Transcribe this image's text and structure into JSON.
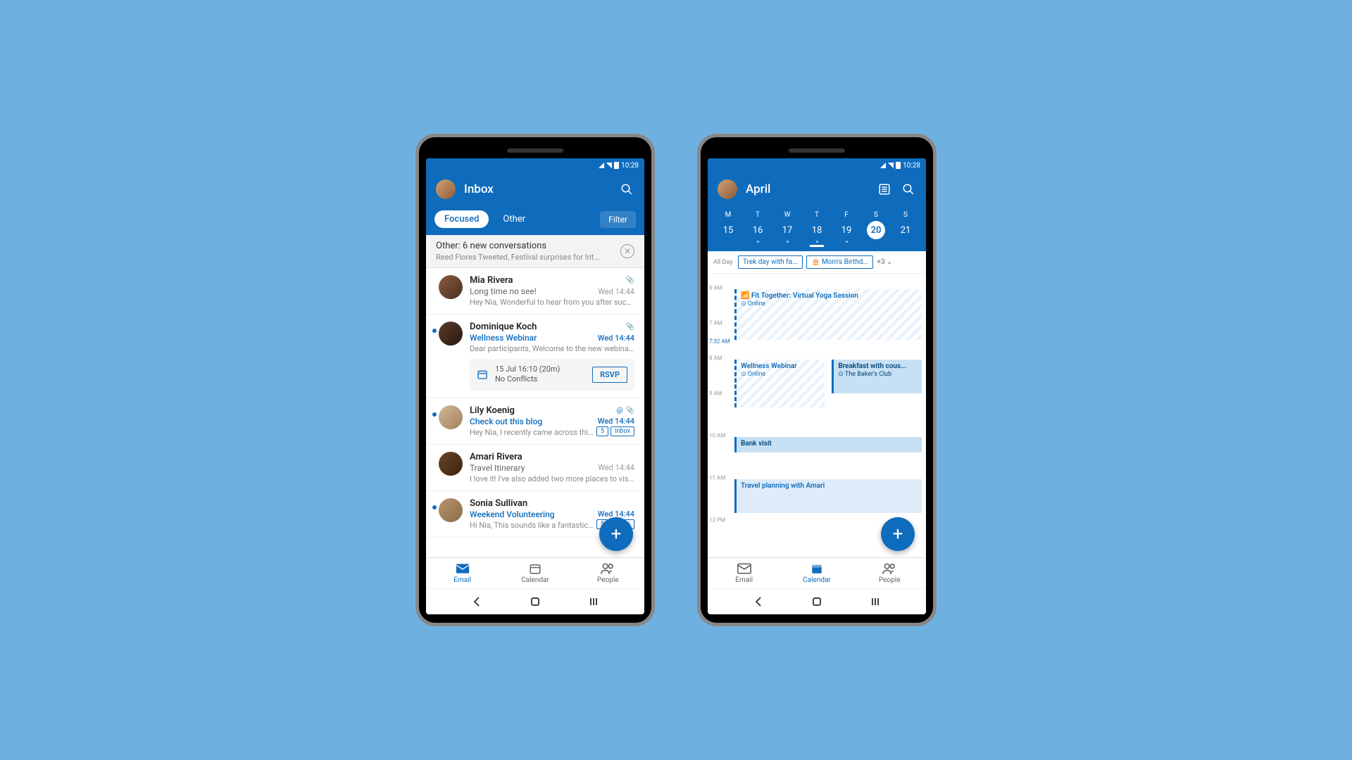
{
  "status": {
    "time": "10:28"
  },
  "inbox": {
    "title": "Inbox",
    "tabs": {
      "focused": "Focused",
      "other": "Other",
      "filter": "Filter"
    },
    "other_banner": {
      "title": "Other: 6 new conversations",
      "sub": "Reed Flores Tweeted, Festival surprises for Int..."
    },
    "emails": [
      {
        "sender": "Mia Rivera",
        "subject": "Long time no see!",
        "time": "Wed 14:44",
        "preview": "Hey Nia, Wonderful to hear from you after such..."
      },
      {
        "sender": "Dominique Koch",
        "subject": "Wellness Webinar",
        "time": "Wed 14:44",
        "preview": "Dear participants, Welcome to the new webinar...",
        "rsvp_time": "15 Jul 16:10 (20m)",
        "rsvp_status": "No Conflicts",
        "rsvp_btn": "RSVP"
      },
      {
        "sender": "Lily Koenig",
        "subject": "Check out this blog",
        "time": "Wed 14:44",
        "preview": "Hey Nia, I recently came across this...",
        "badge_count": "5",
        "badge_folder": "Inbox"
      },
      {
        "sender": "Amari Rivera",
        "subject": "Travel Itinerary",
        "time": "Wed 14:44",
        "preview": "I love it! I've also added two more places to vis..."
      },
      {
        "sender": "Sonia Sullivan",
        "subject": "Weekend Volunteering",
        "time": "Wed 14:44",
        "preview": "Hi Nia, This sounds like a fantastic...",
        "badge_count": "5",
        "badge_folder": "Inbox"
      }
    ]
  },
  "calendar": {
    "title": "April",
    "weekdays": [
      "M",
      "T",
      "W",
      "T",
      "F",
      "S",
      "S"
    ],
    "dates": [
      "15",
      "16",
      "17",
      "18",
      "19",
      "20",
      "21"
    ],
    "allday_label": "All Day",
    "allday_chips": [
      "Trek day with fa...",
      "Mom's Birthd..."
    ],
    "allday_more": "+3",
    "time_labels": [
      "6 AM",
      "7 AM",
      "7:32 AM",
      "8 AM",
      "9 AM",
      "10 AM",
      "11 AM",
      "12 PM"
    ],
    "events": [
      {
        "title": "Fit Together: Virtual Yoga Session",
        "sub": "⊙ Online"
      },
      {
        "title": "Wellness Webinar",
        "sub": "⊙ Online"
      },
      {
        "title": "Breakfast with cous...",
        "sub": "⊙ The Baker's Club"
      },
      {
        "title": "Bank visit"
      },
      {
        "title": "Travel planning with Amari"
      }
    ]
  },
  "nav": {
    "email": "Email",
    "calendar": "Calendar",
    "people": "People"
  }
}
